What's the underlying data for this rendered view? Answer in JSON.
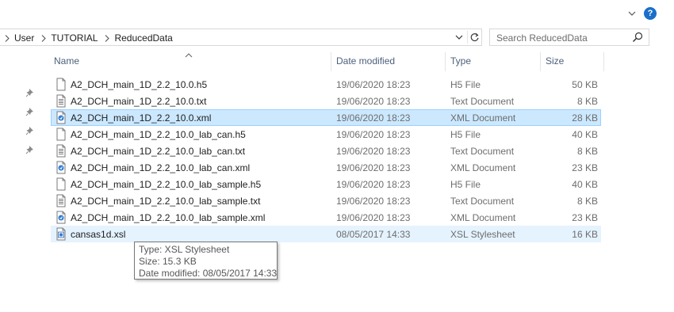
{
  "breadcrumb": [
    "User",
    "TUTORIAL",
    "ReducedData"
  ],
  "search": {
    "placeholder": "Search ReducedData"
  },
  "help_label": "?",
  "columns": {
    "name": "Name",
    "date": "Date modified",
    "type": "Type",
    "size": "Size"
  },
  "files": [
    {
      "name": "A2_DCH_main_1D_2.2_10.0.h5",
      "date": "19/06/2020 18:23",
      "type": "H5 File",
      "size": "50 KB",
      "icon": "file-icon"
    },
    {
      "name": "A2_DCH_main_1D_2.2_10.0.txt",
      "date": "19/06/2020 18:23",
      "type": "Text Document",
      "size": "8 KB",
      "icon": "text-file-icon"
    },
    {
      "name": "A2_DCH_main_1D_2.2_10.0.xml",
      "date": "19/06/2020 18:23",
      "type": "XML Document",
      "size": "28 KB",
      "icon": "xml-file-icon"
    },
    {
      "name": "A2_DCH_main_1D_2.2_10.0_lab_can.h5",
      "date": "19/06/2020 18:23",
      "type": "H5 File",
      "size": "40 KB",
      "icon": "file-icon"
    },
    {
      "name": "A2_DCH_main_1D_2.2_10.0_lab_can.txt",
      "date": "19/06/2020 18:23",
      "type": "Text Document",
      "size": "8 KB",
      "icon": "text-file-icon"
    },
    {
      "name": "A2_DCH_main_1D_2.2_10.0_lab_can.xml",
      "date": "19/06/2020 18:23",
      "type": "XML Document",
      "size": "23 KB",
      "icon": "xml-file-icon"
    },
    {
      "name": "A2_DCH_main_1D_2.2_10.0_lab_sample.h5",
      "date": "19/06/2020 18:23",
      "type": "H5 File",
      "size": "40 KB",
      "icon": "file-icon"
    },
    {
      "name": "A2_DCH_main_1D_2.2_10.0_lab_sample.txt",
      "date": "19/06/2020 18:23",
      "type": "Text Document",
      "size": "8 KB",
      "icon": "text-file-icon"
    },
    {
      "name": "A2_DCH_main_1D_2.2_10.0_lab_sample.xml",
      "date": "19/06/2020 18:23",
      "type": "XML Document",
      "size": "23 KB",
      "icon": "xml-file-icon"
    },
    {
      "name": "cansas1d.xsl",
      "date": "08/05/2017 14:33",
      "type": "XSL Stylesheet",
      "size": "16 KB",
      "icon": "xsl-file-icon"
    }
  ],
  "tooltip": {
    "type_line": "Type: XSL Stylesheet",
    "size_line": "Size: 15.3 KB",
    "date_line": "Date modified: 08/05/2017 14:33"
  },
  "colors": {
    "selected_bg": "#cce8ff",
    "hover_bg": "#e5f3ff",
    "header_text": "#4c607a",
    "accent": "#1a6fc9"
  }
}
